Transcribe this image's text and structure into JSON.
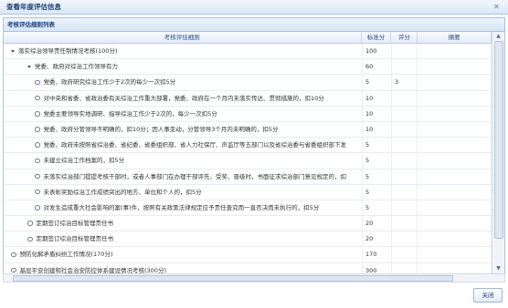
{
  "dialog": {
    "title": "查看年度评估信息"
  },
  "panel": {
    "title": "考核评估细则列表"
  },
  "columns": {
    "rule": "考核评估细则",
    "std": "标准分",
    "score": "评分",
    "summary": "摘要"
  },
  "rows": [
    {
      "label": "落实综治领导责任制情况考核(100分)",
      "std": "100",
      "score": "",
      "level": 0,
      "marker": "triangle"
    },
    {
      "label": "党委、政府对综治工作领导有力",
      "std": "60",
      "score": "",
      "level": 1,
      "marker": "triangle"
    },
    {
      "label": "党委、政府研究综治工作少于2次的每少一次扣5分",
      "std": "5",
      "score": "3",
      "level": 2,
      "marker": "dot"
    },
    {
      "label": "对中央和省委、省政治委有关综治工作重大部署，党委、政府在一个月内未落实传达、贯彻措施的，扣10分",
      "std": "10",
      "score": "",
      "level": 2,
      "marker": "dot"
    },
    {
      "label": "党委主要领导实地调研、指导综治工作少于2次的，每少一次扣5分",
      "std": "10",
      "score": "",
      "level": 2,
      "marker": "dot"
    },
    {
      "label": "党委、政府分管领导不明确的，扣10分；因人事变动，分管领导3个月内未明确的，扣5分",
      "std": "10",
      "score": "",
      "level": 2,
      "marker": "dot"
    },
    {
      "label": "党委、政府未按照省综治委、省纪委、省委组织部、省人力社保厅、声监厅等五部门以及省综治委与省委组织部下发",
      "std": "5",
      "score": "",
      "level": 2,
      "marker": "dot"
    },
    {
      "label": "未建立综治工作档案的，扣5分",
      "std": "5",
      "score": "",
      "level": 2,
      "marker": "dot"
    },
    {
      "label": "未落实综治部门提提考核干部时，或者人事部门在办理干部评先、受奖、晋级时，书面征求综治部门意见规定的，扣",
      "std": "5",
      "score": "",
      "level": 2,
      "marker": "dot"
    },
    {
      "label": "未表彰奖励综治工作成绩突出的地方、单位和个人的，扣5分",
      "std": "5",
      "score": "",
      "level": 2,
      "marker": "dot"
    },
    {
      "label": "对发生造成重大社会影响的案(事)件，按照有关政策法律规定应予责任查究而一直否决而未执行的，扣5分",
      "std": "5",
      "score": "",
      "level": 2,
      "marker": "dot"
    },
    {
      "label": "定期签订综治目标管理责任书",
      "std": "20",
      "score": "",
      "level": 1,
      "marker": "dot"
    },
    {
      "label": "定期签订综治目标管理责任书",
      "std": "20",
      "score": "",
      "level": 1,
      "marker": "dot"
    },
    {
      "label": "预防化解矛盾纠纷工作情况(170分)",
      "std": "170",
      "score": "",
      "level": 0,
      "marker": "dot"
    },
    {
      "label": "基层平安创建和社会治安防控体系建设情况考核(300分)",
      "std": "300",
      "score": "",
      "level": 0,
      "marker": "dot"
    }
  ],
  "footer": {
    "close_label": "关闭"
  }
}
